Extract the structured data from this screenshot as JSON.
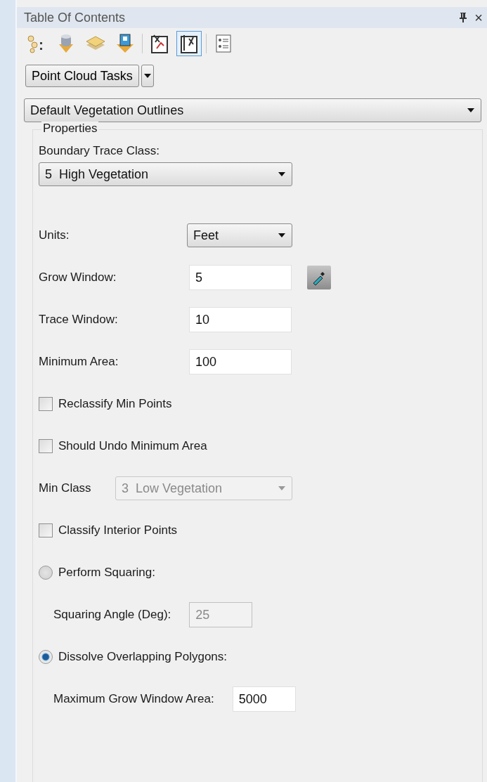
{
  "window": {
    "title": "Table Of Contents",
    "close": "×"
  },
  "toolbar": [
    {
      "kind": "order",
      "selected": false
    },
    {
      "kind": "source",
      "selected": false
    },
    {
      "kind": "layers",
      "selected": false
    },
    {
      "kind": "selection",
      "selected": false
    },
    {
      "kind": "sep"
    },
    {
      "kind": "edit",
      "selected": false
    },
    {
      "kind": "task",
      "selected": true
    },
    {
      "kind": "sep"
    },
    {
      "kind": "list",
      "selected": false
    }
  ],
  "task_button": {
    "label": "Point Cloud Tasks"
  },
  "preset": {
    "value": "Default Vegetation Outlines"
  },
  "properties": {
    "title": "Properties",
    "rows": [
      {
        "kind": "stacked",
        "label": "Boundary Trace Class:",
        "value": "5  High Vegetation",
        "disabled": false
      },
      {
        "kind": "select",
        "label": "Units:",
        "value": "Feet",
        "disabled": false
      },
      {
        "kind": "input",
        "label": "Grow Window:",
        "value": "5",
        "disabled": false,
        "picker": true
      },
      {
        "kind": "input",
        "label": "Trace Window:",
        "value": "10",
        "disabled": false
      },
      {
        "kind": "input",
        "label": "Minimum Area:",
        "value": "100",
        "disabled": false
      },
      {
        "kind": "checkbox",
        "label": "Reclassify Min Points",
        "checked": false
      },
      {
        "kind": "checkbox",
        "label": "Should Undo Minimum Area",
        "checked": false
      },
      {
        "kind": "wide-select",
        "label": "Min Class",
        "value": "3  Low Vegetation",
        "disabled": true
      },
      {
        "kind": "checkbox",
        "label": "Classify Interior Points",
        "checked": false
      },
      {
        "kind": "radio",
        "label": "Perform Squaring:",
        "selected": false
      },
      {
        "kind": "sub-input",
        "label": "Squaring Angle (Deg):",
        "value": "25",
        "disabled": true
      },
      {
        "kind": "radio",
        "label": "Dissolve Overlapping Polygons:",
        "selected": true
      },
      {
        "kind": "sub-input",
        "label": "Maximum Grow Window Area:",
        "value": "5000",
        "disabled": false
      }
    ]
  }
}
